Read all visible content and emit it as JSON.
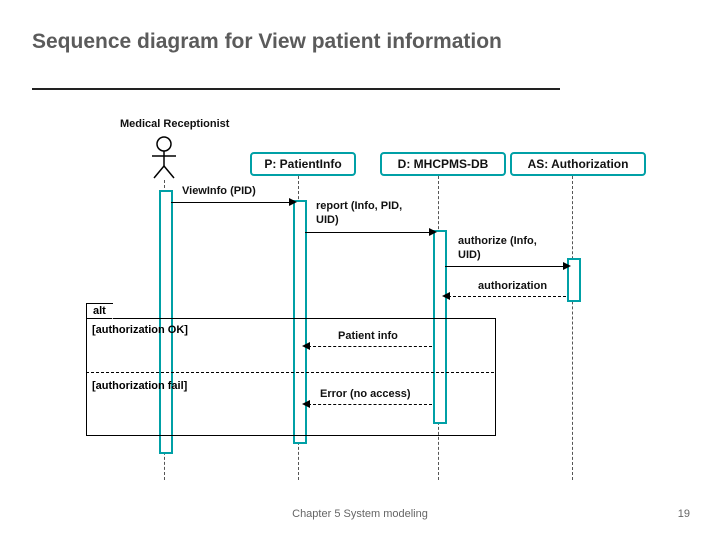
{
  "slide": {
    "title": "Sequence diagram for View patient information",
    "footer": "Chapter 5 System modeling",
    "page": "19"
  },
  "actors": {
    "actor_label": "Medical Receptionist",
    "p_label": "P: PatientInfo",
    "d_label": "D: MHCPMS-DB",
    "as_label": "AS: Authorization"
  },
  "messages": {
    "view": "ViewInfo (PID)",
    "report1": "report (Info, PID,",
    "report2": "UID)",
    "authorize1": "authorize (Info,",
    "authorize2": "UID)",
    "authz_return": "authorization",
    "patient_info": "Patient info",
    "error": "Error (no access)"
  },
  "alt": {
    "tag": "alt",
    "guard_ok": "[authorization OK]",
    "guard_fail": "[authorization fail]"
  }
}
